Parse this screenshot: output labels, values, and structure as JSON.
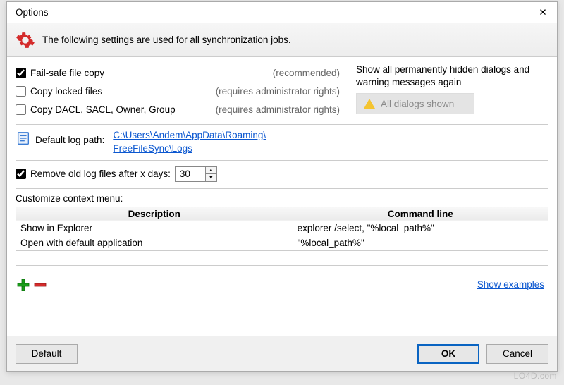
{
  "window": {
    "title": "Options"
  },
  "infobar": {
    "text": "The following settings are used for all synchronization jobs."
  },
  "options": {
    "failsafe": {
      "label": "Fail-safe file copy",
      "hint": "(recommended)",
      "checked": true
    },
    "locked": {
      "label": "Copy locked files",
      "hint": "(requires administrator rights)",
      "checked": false
    },
    "dacl": {
      "label": "Copy DACL, SACL, Owner, Group",
      "hint": "(requires administrator rights)",
      "checked": false
    }
  },
  "hiddenDialogs": {
    "text": "Show all permanently hidden dialogs and warning messages again",
    "button": "All dialogs shown"
  },
  "log": {
    "label": "Default log path:",
    "path_line1": "C:\\Users\\Andem\\AppData\\Roaming\\",
    "path_line2": "FreeFileSync\\Logs",
    "remove_label": "Remove old log files after x days:",
    "remove_checked": true,
    "days": "30"
  },
  "contextMenu": {
    "label": "Customize context menu:",
    "headers": {
      "desc": "Description",
      "cmd": "Command line"
    },
    "rows": [
      {
        "desc": "Show in Explorer",
        "cmd": "explorer /select, \"%local_path%\""
      },
      {
        "desc": "Open with default application",
        "cmd": "\"%local_path%\""
      },
      {
        "desc": "",
        "cmd": ""
      }
    ],
    "showExamples": "Show examples"
  },
  "footer": {
    "default": "Default",
    "ok": "OK",
    "cancel": "Cancel"
  },
  "watermark": "LO4D.com"
}
